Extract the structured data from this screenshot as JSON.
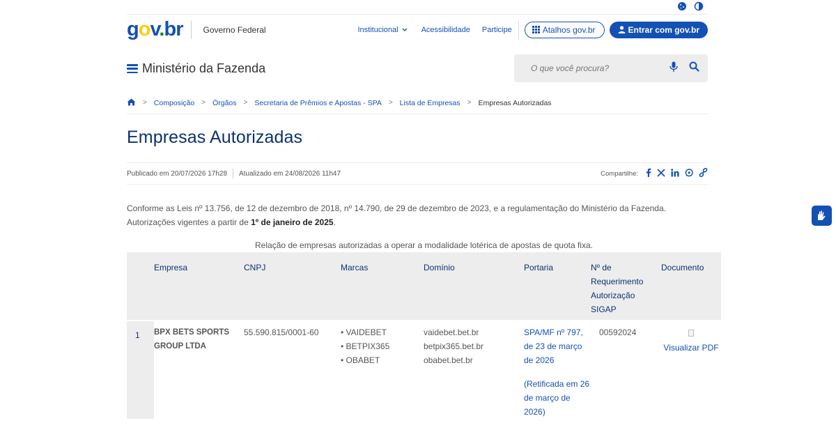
{
  "top_icons": [
    "cookie-icon",
    "contrast-icon"
  ],
  "logo": {
    "g": "g",
    "o1": "o",
    "v": "v",
    "dot": ".",
    "br": "br"
  },
  "header": {
    "gov_label": "Governo Federal",
    "nav": [
      {
        "label": "Institucional",
        "has_chevron": true
      },
      {
        "label": "Acessibilidade"
      },
      {
        "label": "Participe"
      }
    ],
    "atalhos_label": "Atalhos gov.br",
    "entrar_label": "Entrar com gov.br"
  },
  "site": {
    "name": "Ministério da Fazenda"
  },
  "search": {
    "placeholder": "O que você procura?"
  },
  "breadcrumb": {
    "items": [
      "Composição",
      "Órgãos",
      "Secretaria de Prêmios e Apostas - SPA",
      "Lista de Empresas"
    ],
    "current": "Empresas Autorizadas"
  },
  "page": {
    "title": "Empresas Autorizadas",
    "published": "Publicado em 20/07/2026 17h28",
    "updated": "Atualizado em 24/08/2026 11h47",
    "share_label": "Compartilhe:",
    "intro_line1": "Conforme as Leis nº 13.756, de 12 de dezembro de 2018, nº 14.790, de 29 de dezembro de 2023, e a regulamentação do Ministério da Fazenda.",
    "intro_line2_prefix": "Autorizações vigentes a partir de ",
    "intro_line2_bold": "1º de janeiro de 2025",
    "intro_line2_suffix": ".",
    "caption": "Relação de empresas autorizadas a operar a modalidade lotérica de apostas de quota fixa."
  },
  "table": {
    "headers": [
      "",
      "Empresa",
      "CNPJ",
      "Marcas",
      "Domínio",
      "Portaria",
      "Nº de Requerimento Autorização SIGAP",
      "Documento"
    ],
    "rows": [
      {
        "num": "1",
        "empresa": "BPX BETS SPORTS GROUP LTDA",
        "cnpj": "55.590.815/0001-60",
        "marcas": [
          "VAIDEBET",
          "BETPIX365",
          "OBABET"
        ],
        "dominios": [
          "vaidebet.bet.br",
          "betpix365.bet.br",
          "obabet.bet.br"
        ],
        "portaria": "SPA/MF nº 797, de 23 de março de 2026",
        "portaria_note": "(Retificada em 26 de março de 2026)",
        "requerimento": "00592024",
        "documento": "Visualizar PDF"
      }
    ]
  }
}
